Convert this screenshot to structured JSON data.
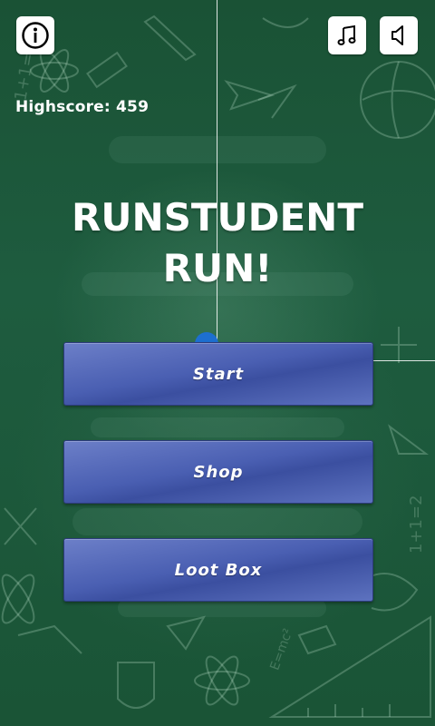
{
  "app": {
    "highscore_text": "Highscore: 459",
    "title_line1": "RunStudent",
    "title_line2": "Run!"
  },
  "top_bar": {
    "info_icon": "info-icon",
    "music_icon": "music-note-icon",
    "sound_icon": "speaker-icon"
  },
  "menu": {
    "start_label": "Start",
    "shop_label": "Shop",
    "lootbox_label": "Loot Box"
  },
  "colors": {
    "chalkboard": "#1f5a3c",
    "button_blue": "#4a5fb2",
    "dot_blue": "#1d6fd0",
    "text": "#ffffff"
  }
}
